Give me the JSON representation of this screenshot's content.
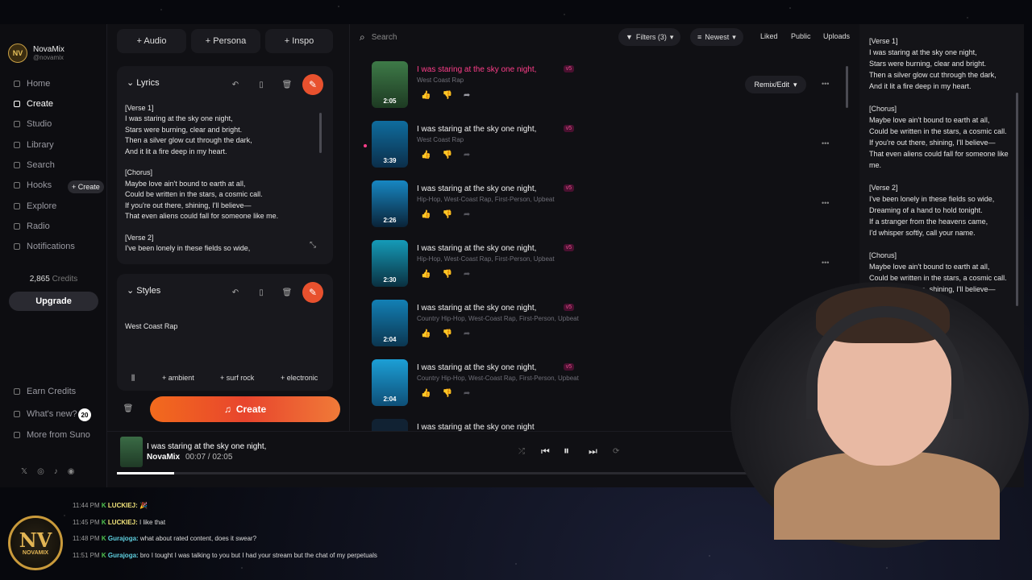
{
  "brand": {
    "name": "NovaMix",
    "handle": "@novamix",
    "logo_text": "NV"
  },
  "nav": [
    {
      "label": "Home",
      "icon": "home-icon"
    },
    {
      "label": "Create",
      "icon": "music-note-icon",
      "active": true
    },
    {
      "label": "Studio",
      "icon": "studio-icon"
    },
    {
      "label": "Library",
      "icon": "library-icon"
    },
    {
      "label": "Search",
      "icon": "search-icon"
    },
    {
      "label": "Hooks",
      "icon": "hooks-icon"
    },
    {
      "label": "Explore",
      "icon": "explore-icon"
    },
    {
      "label": "Radio",
      "icon": "radio-icon"
    },
    {
      "label": "Notifications",
      "icon": "bell-icon"
    }
  ],
  "hooks_create": "+ Create",
  "credits": {
    "count": "2,865",
    "label": "Credits"
  },
  "upgrade_label": "Upgrade",
  "nav_bottom": [
    {
      "label": "Earn Credits"
    },
    {
      "label": "What's new?",
      "badge": "20"
    },
    {
      "label": "More from Suno"
    }
  ],
  "social": [
    "𝕏",
    "◎",
    "♪",
    "◉"
  ],
  "create_tabs": [
    "+ Audio",
    "+ Persona",
    "+ Inspo"
  ],
  "lyrics_card": {
    "title": "Lyrics",
    "text": "[Verse 1]\nI was staring at the sky one night,\nStars were burning, clear and bright.\nThen a silver glow cut through the dark,\nAnd it lit a fire deep in my heart.\n\n[Chorus]\nMaybe love ain't bound to earth at all,\nCould be written in the stars, a cosmic call.\nIf you're out there, shining, I'll believe—\nThat even aliens could fall for someone like me.\n\n[Verse 2]\nI've been lonely in these fields so wide,"
  },
  "styles_card": {
    "title": "Styles",
    "value": "West Coast Rap",
    "tags": [
      "+ ambient",
      "+ surf rock",
      "+ electronic"
    ]
  },
  "create_button": "Create",
  "list_toolbar": {
    "search_placeholder": "Search",
    "filters": "Filters (3)",
    "sort": "Newest",
    "liked": "Liked",
    "public": "Public",
    "uploads": "Uploads"
  },
  "remix_label": "Remix/Edit",
  "songs": [
    {
      "title": "I was staring at the sky one night,",
      "version": "v5",
      "style": "West Coast Rap",
      "duration": "2:05",
      "playing": true,
      "thumb": [
        "#3e7a48",
        "#1d3a22"
      ]
    },
    {
      "title": "I was staring at the sky one night,",
      "version": "v5",
      "style": "West Coast Rap",
      "duration": "3:39",
      "playing": false,
      "thumb": [
        "#0f6d9e",
        "#0b2e4a"
      ]
    },
    {
      "title": "I was staring at the sky one night,",
      "version": "v5",
      "style": "Hip-Hop, West-Coast Rap, First-Person, Upbeat",
      "duration": "2:26",
      "playing": false,
      "thumb": [
        "#1787c2",
        "#0a2338"
      ]
    },
    {
      "title": "I was staring at the sky one night,",
      "version": "v5",
      "style": "Hip-Hop, West-Coast Rap, First-Person, Upbeat",
      "duration": "2:30",
      "playing": false,
      "thumb": [
        "#159bb8",
        "#0a3040"
      ]
    },
    {
      "title": "I was staring at the sky one night,",
      "version": "v5",
      "style": "Country Hip-Hop, West-Coast Rap, First-Person, Upbeat",
      "duration": "2:04",
      "playing": false,
      "thumb": [
        "#1380b5",
        "#0b3650"
      ]
    },
    {
      "title": "I was staring at the sky one night,",
      "version": "v5",
      "style": "Country Hip-Hop, West-Coast Rap, First-Person, Upbeat",
      "duration": "2:04",
      "playing": false,
      "thumb": [
        "#1c9fd6",
        "#0e4f77"
      ]
    },
    {
      "title": "I was staring at the sky one night",
      "version": "",
      "style": "",
      "duration": "",
      "playing": false,
      "thumb": [
        "#123",
        "#123"
      ]
    }
  ],
  "right_lyrics": "[Verse 1]\nI was staring at the sky one night,\nStars were burning, clear and bright.\nThen a silver glow cut through the dark,\nAnd it lit a fire deep in my heart.\n\n[Chorus]\nMaybe love ain't bound to earth at all,\nCould be written in the stars, a cosmic call.\nIf you're out there, shining, I'll believe—\nThat even aliens could fall for someone like me.\n\n[Verse 2]\nI've been lonely in these fields so wide,\nDreaming of a hand to hold tonight.\nIf a stranger from the heavens came,\nI'd whisper softly, call your name.\n\n[Chorus]\nMaybe love ain't bound to earth at all,\nCould be written in the stars, a cosmic call.\nIf you're out there, shining, I'll believe—",
  "player": {
    "title": "I was staring at the sky one night,",
    "artist": "NovaMix",
    "time": "00:07 /  02:05",
    "progress": 0.079
  },
  "chat": [
    {
      "time": "11:44 PM",
      "user": "LUCKIEJ:",
      "msg": "🎉",
      "color": "u1"
    },
    {
      "time": "11:45 PM",
      "user": "LUCKIEJ:",
      "msg": "I like that",
      "color": "u1"
    },
    {
      "time": "11:48 PM",
      "user": "Gurajoga:",
      "msg": "what about rated content, does it swear?",
      "color": "u2"
    },
    {
      "time": "11:51 PM",
      "user": "Gurajoga:",
      "msg": "bro I tought I was talking to you but I had your stream but the chat of my perpetuals",
      "color": "u2"
    }
  ],
  "overlay_logo": {
    "big": "NV",
    "small": "NOVAMIX"
  }
}
